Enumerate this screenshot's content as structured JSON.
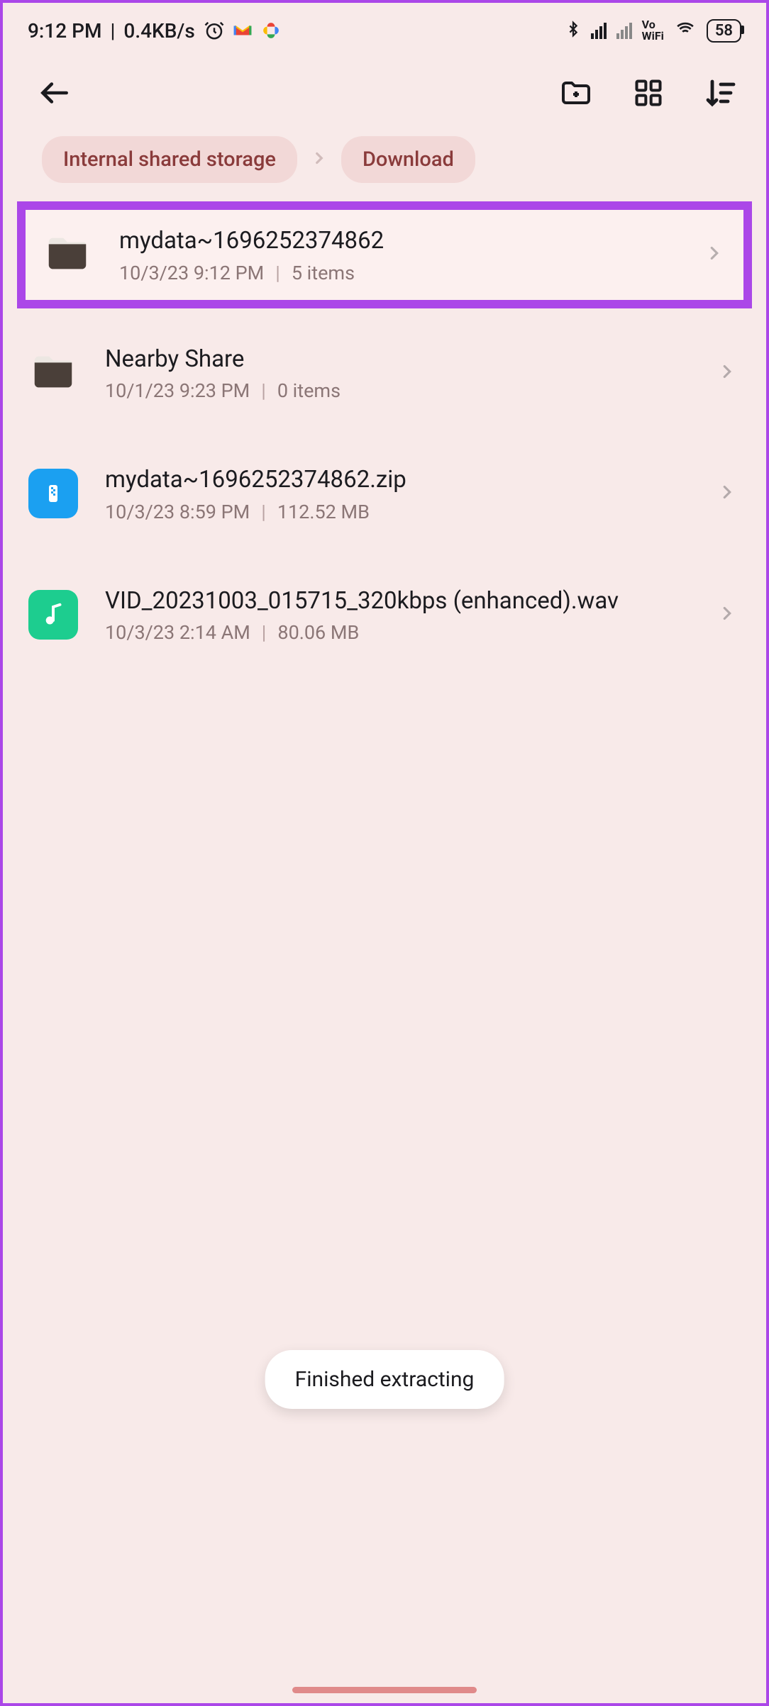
{
  "status": {
    "time": "9:12 PM",
    "network_speed": "0.4KB/s",
    "battery": "58",
    "vowifi_top": "Vo",
    "vowifi_bottom": "WiFi"
  },
  "breadcrumb": {
    "root": "Internal shared storage",
    "current": "Download"
  },
  "rows": [
    {
      "name": "mydata~1696252374862",
      "date": "10/3/23 9:12 PM",
      "size": "5 items"
    },
    {
      "name": "Nearby Share",
      "date": "10/1/23 9:23 PM",
      "size": "0 items"
    },
    {
      "name": "mydata~1696252374862.zip",
      "date": "10/3/23 8:59 PM",
      "size": "112.52 MB"
    },
    {
      "name": "VID_20231003_015715_320kbps (enhanced).wav",
      "date": "10/3/23 2:14 AM",
      "size": "80.06 MB"
    }
  ],
  "toast": "Finished extracting"
}
